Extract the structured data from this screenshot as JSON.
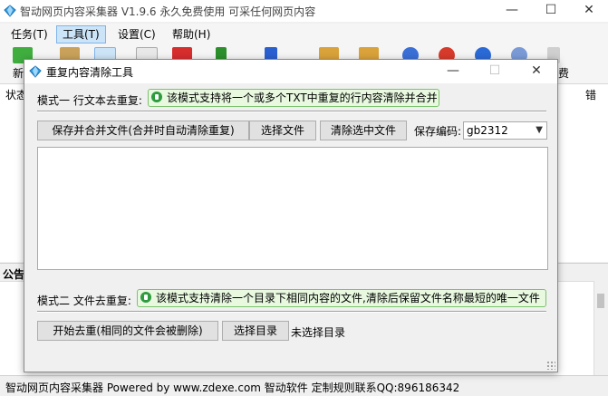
{
  "main_window": {
    "title": "智动网页内容采集器 V1.9.6 永久免费使用 可采任何网页内容",
    "controls": {
      "minimize": "—",
      "maximize": "☐",
      "close": "✕"
    }
  },
  "menu": {
    "items": [
      {
        "label": "任务(T)"
      },
      {
        "label": "工具(T)"
      },
      {
        "label": "设置(C)"
      },
      {
        "label": "帮助(H)"
      }
    ]
  },
  "toolbar": {
    "partial_left_label": "新",
    "partial_right_label": "费"
  },
  "list_header": {
    "left_label": "状态",
    "right_label": "错"
  },
  "notice_header": {
    "label": "公告"
  },
  "statusbar": {
    "text": "智动网页内容采集器 Powered by www.zdexe.com 智动软件 定制规则联系QQ:896186342"
  },
  "dialog": {
    "title": "重复内容清除工具",
    "controls": {
      "minimize": "—",
      "maximize": "☐",
      "close": "✕"
    },
    "mode1": {
      "label": "模式一 行文本去重复:",
      "hint": "该模式支持将一个或多个TXT中重复的行内容清除并合并",
      "save_merge_button": "保存并合并文件(合并时自动清除重复)",
      "select_file_button": "选择文件",
      "clear_selected_button": "清除选中文件",
      "encoding_label": "保存编码:",
      "encoding_value": "gb2312",
      "textarea_value": ""
    },
    "mode2": {
      "label": "模式二 文件去重复:",
      "hint": "该模式支持清除一个目录下相同内容的文件,清除后保留文件名称最短的唯一文件",
      "start_button": "开始去重(相同的文件会被删除)",
      "select_dir_button": "选择目录",
      "dir_status": "未选择目录"
    }
  },
  "colors": {
    "hint_bg": "#e8f9e0",
    "hint_border": "#7bc26e",
    "menu_active_bg": "#cce4f7",
    "divider": "#a0a0a0"
  }
}
